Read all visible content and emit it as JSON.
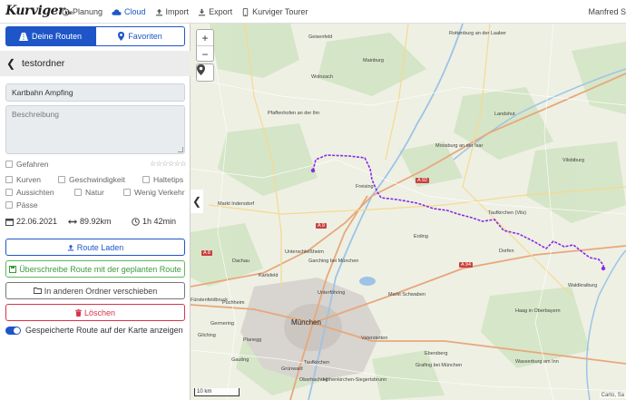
{
  "header": {
    "logo": "Kurviger",
    "logo_suffix": ".de",
    "nav": [
      {
        "label": "Planung",
        "icon": "compass-icon"
      },
      {
        "label": "Cloud",
        "icon": "cloud-icon"
      },
      {
        "label": "Import",
        "icon": "upload-icon"
      },
      {
        "label": "Export",
        "icon": "download-icon"
      },
      {
        "label": "Kurviger Tourer",
        "icon": "phone-icon"
      }
    ],
    "user": "Manfred S"
  },
  "tabs": {
    "routes": "Deine Routen",
    "favorites": "Favoriten"
  },
  "folder": {
    "title": "testordner"
  },
  "route": {
    "name": "Kartbahn Ampfing",
    "description_placeholder": "Beschreibung",
    "date": "22.06.2021",
    "distance": "89.92km",
    "duration": "1h 42min"
  },
  "flags": {
    "gefahren": "Gefahren",
    "kurven": "Kurven",
    "geschwindigkeit": "Geschwindigkeit",
    "haltetips": "Haltetips",
    "aussichten": "Aussichten",
    "natur": "Natur",
    "wenig_verkehr": "Wenig Verkehr",
    "paesse": "Pässe",
    "rating": 0,
    "rating_max": 6
  },
  "buttons": {
    "load": "Route Laden",
    "overwrite": "Überschreibe Route mit der geplanten Route",
    "move": "In anderen Ordner verschieben",
    "delete": "Löschen"
  },
  "toggle": {
    "label": "Gespeicherte Route auf der Karte anzeigen",
    "on": true
  },
  "map": {
    "zoom_in": "+",
    "zoom_out": "−",
    "scale": "10 km",
    "attribution": "Carto, Sa",
    "route_color": "#8a2be2",
    "cities": [
      {
        "name": "Geisenfeld"
      },
      {
        "name": "Mainburg"
      },
      {
        "name": "Rottenburg an der Laaber"
      },
      {
        "name": "Wolnzach"
      },
      {
        "name": "Pfaffenhofen an der Ilm"
      },
      {
        "name": "Landshut"
      },
      {
        "name": "Moosburg an der Isar"
      },
      {
        "name": "Vilsbiburg"
      },
      {
        "name": "Freising"
      },
      {
        "name": "Taufkirchen (Vils)"
      },
      {
        "name": "Markt Indersdorf"
      },
      {
        "name": "Erding"
      },
      {
        "name": "Dorfen"
      },
      {
        "name": "Unterschleißheim"
      },
      {
        "name": "Dachau"
      },
      {
        "name": "Garching bei München"
      },
      {
        "name": "Karlsfeld"
      },
      {
        "name": "Unterföhring"
      },
      {
        "name": "Markt Schwaben"
      },
      {
        "name": "Waldkraiburg"
      },
      {
        "name": "Puchheim"
      },
      {
        "name": "Germering"
      },
      {
        "name": "München"
      },
      {
        "name": "Haag in Oberbayern"
      },
      {
        "name": "Planegg"
      },
      {
        "name": "Vaterstetten"
      },
      {
        "name": "Gauting"
      },
      {
        "name": "Grünwald"
      },
      {
        "name": "Taufkirchen"
      },
      {
        "name": "Ebersberg"
      },
      {
        "name": "Grafing bei München"
      },
      {
        "name": "Wasserburg am Inn"
      },
      {
        "name": "Höhenkirchen-Siegertsbrunn"
      },
      {
        "name": "Oberhaching"
      },
      {
        "name": "Gilching"
      },
      {
        "name": "Fürstenfeldbruck"
      }
    ],
    "roads": [
      "A 92",
      "A 9",
      "A 8",
      "A 94"
    ]
  }
}
